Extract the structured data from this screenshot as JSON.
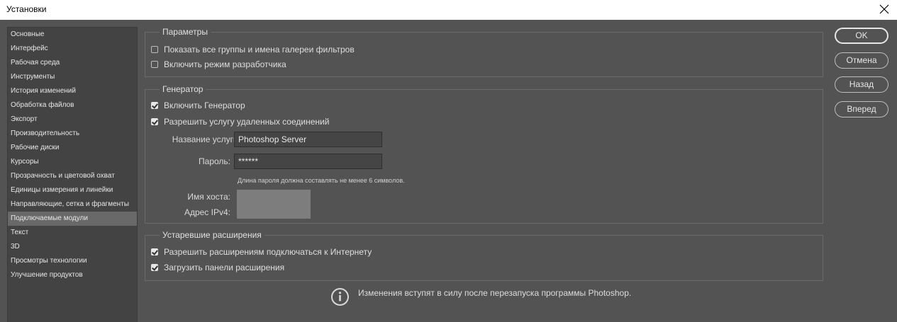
{
  "window": {
    "title": "Установки"
  },
  "sidebar": {
    "items": [
      {
        "label": "Основные"
      },
      {
        "label": "Интерфейс"
      },
      {
        "label": "Рабочая среда"
      },
      {
        "label": "Инструменты"
      },
      {
        "label": "История изменений"
      },
      {
        "label": "Обработка файлов"
      },
      {
        "label": "Экспорт"
      },
      {
        "label": "Производительность"
      },
      {
        "label": "Рабочие диски"
      },
      {
        "label": "Курсоры"
      },
      {
        "label": "Прозрачность и цветовой охват"
      },
      {
        "label": "Единицы измерения и линейки"
      },
      {
        "label": "Направляющие, сетка и фрагменты"
      },
      {
        "label": "Подключаемые модули",
        "selected": true
      },
      {
        "label": "Текст"
      },
      {
        "label": "3D"
      },
      {
        "label": "Просмотры технологии"
      },
      {
        "label": "Улучшение продуктов"
      }
    ]
  },
  "params": {
    "title": "Параметры",
    "show_filter_gallery": {
      "label": "Показать все группы и имена галереи фильтров",
      "checked": false
    },
    "developer_mode": {
      "label": "Включить режим разработчика",
      "checked": false
    }
  },
  "generator": {
    "title": "Генератор",
    "enable_generator": {
      "label": "Включить Генератор",
      "checked": true
    },
    "allow_remote": {
      "label": "Разрешить услугу удаленных соединений",
      "checked": true
    },
    "service_name_label": "Название услуги:",
    "service_name_value": "Photoshop Server",
    "password_label": "Пароль:",
    "password_value": "******",
    "password_hint": "Длина пароля должна составлять не менее 6 символов.",
    "host_label": "Имя хоста:",
    "ipv4_label": "Адрес IPv4:"
  },
  "legacy": {
    "title": "Устаревшие расширения",
    "allow_internet": {
      "label": "Разрешить расширениям подключаться к Интернету",
      "checked": true
    },
    "load_panels": {
      "label": "Загрузить панели расширения",
      "checked": true
    }
  },
  "buttons": {
    "ok": "OK",
    "cancel": "Отмена",
    "back": "Назад",
    "forward": "Вперед"
  },
  "notice": {
    "text": "Изменения вступят в силу после перезапуска программы Photoshop."
  },
  "icons": {
    "close": "close-icon",
    "info": "info-icon",
    "checkbox": "checkbox-icon"
  }
}
